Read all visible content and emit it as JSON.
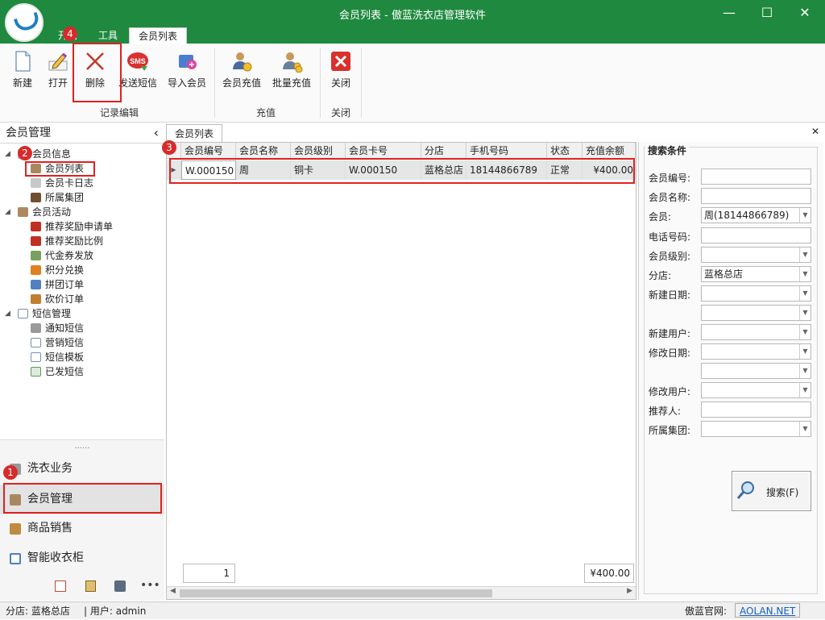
{
  "window": {
    "title": "会员列表 - 傲蓝洗衣店管理软件",
    "minimize": "—",
    "maximize": "☐",
    "close": "✕"
  },
  "menu_tabs": [
    {
      "label": "开始"
    },
    {
      "label": "工具"
    },
    {
      "label": "会员列表"
    }
  ],
  "ribbon": {
    "buttons": [
      {
        "label": "新建",
        "icon": "new-document-icon"
      },
      {
        "label": "打开",
        "icon": "edit-pencil-icon"
      },
      {
        "label": "删除",
        "icon": "delete-x-icon"
      },
      {
        "label": "发送短信",
        "icon": "sms-icon"
      },
      {
        "label": "导入会员",
        "icon": "import-icon"
      },
      {
        "label": "会员充值",
        "icon": "member-coin-icon"
      },
      {
        "label": "批量充值",
        "icon": "batch-coin-icon"
      },
      {
        "label": "关闭",
        "icon": "close-red-icon"
      }
    ],
    "groups": [
      "记录编辑",
      "充值",
      "关闭"
    ]
  },
  "sidebar": {
    "title": "会员管理",
    "collapse": "‹",
    "tree": [
      {
        "label": "会员信息",
        "level": 0,
        "icon": "member-folder-icon"
      },
      {
        "label": "会员列表",
        "level": 1,
        "icon": "member-icon"
      },
      {
        "label": "会员卡日志",
        "level": 1,
        "icon": "card-icon"
      },
      {
        "label": "所属集团",
        "level": 1,
        "icon": "group-icon"
      },
      {
        "label": "会员活动",
        "level": 0,
        "icon": "member-activity-icon"
      },
      {
        "label": "推荐奖励申请单",
        "level": 1,
        "icon": "reward-icon"
      },
      {
        "label": "推荐奖励比例",
        "level": 1,
        "icon": "reward-icon"
      },
      {
        "label": "代金券发放",
        "level": 1,
        "icon": "voucher-icon"
      },
      {
        "label": "积分兑换",
        "level": 1,
        "icon": "points-icon"
      },
      {
        "label": "拼团订单",
        "level": 1,
        "icon": "team-icon"
      },
      {
        "label": "砍价订单",
        "level": 1,
        "icon": "bargain-icon"
      },
      {
        "label": "短信管理",
        "level": 0,
        "icon": "mail-icon"
      },
      {
        "label": "通知短信",
        "level": 1,
        "icon": "speaker-icon"
      },
      {
        "label": "营销短信",
        "level": 1,
        "icon": "mail-icon"
      },
      {
        "label": "短信模板",
        "level": 1,
        "icon": "mail-icon"
      },
      {
        "label": "已发短信",
        "level": 1,
        "icon": "sent-mail-icon"
      }
    ],
    "grip": "......",
    "nav": [
      {
        "label": "洗衣业务",
        "icon": "laundry-icon"
      },
      {
        "label": "会员管理",
        "icon": "member-icon"
      },
      {
        "label": "商品销售",
        "icon": "box-icon"
      },
      {
        "label": "智能收衣柜",
        "icon": "cabinet-icon"
      }
    ],
    "more": "•••"
  },
  "doc_tab": {
    "label": "会员列表",
    "close": "✕"
  },
  "grid": {
    "columns": [
      "会员编号",
      "会员名称",
      "会员级别",
      "会员卡号",
      "分店",
      "手机号码",
      "状态",
      "充值余额"
    ],
    "rows": [
      [
        "W.000150",
        "周",
        "铜卡",
        "W.000150",
        "蓝格总店",
        "18144866789",
        "正常",
        "¥400.00"
      ]
    ],
    "footer_count": "1",
    "footer_total": "¥400.00"
  },
  "search": {
    "title": "搜索条件",
    "fields": [
      {
        "label": "会员编号:",
        "value": "",
        "dropdown": false
      },
      {
        "label": "会员名称:",
        "value": "",
        "dropdown": false
      },
      {
        "label": "会员:",
        "value": "周(18144866789)",
        "dropdown": true
      },
      {
        "label": "电话号码:",
        "value": "",
        "dropdown": false
      },
      {
        "label": "会员级别:",
        "value": "",
        "dropdown": true
      },
      {
        "label": "分店:",
        "value": "蓝格总店",
        "dropdown": true
      },
      {
        "label": "新建日期:",
        "value": "",
        "dropdown": true
      },
      {
        "label": "",
        "value": "",
        "dropdown": true
      },
      {
        "label": "新建用户:",
        "value": "",
        "dropdown": true
      },
      {
        "label": "修改日期:",
        "value": "",
        "dropdown": true
      },
      {
        "label": "",
        "value": "",
        "dropdown": true
      },
      {
        "label": "修改用户:",
        "value": "",
        "dropdown": true
      },
      {
        "label": "推荐人:",
        "value": "",
        "dropdown": false
      },
      {
        "label": "所属集团:",
        "value": "",
        "dropdown": true
      }
    ],
    "button": "搜索(F)"
  },
  "status": {
    "store": "分店: 蓝格总店",
    "user": "| 用户: admin",
    "site_label": "傲蓝官网:",
    "site": "AOLAN.NET"
  },
  "badges": [
    "1",
    "2",
    "3",
    "4"
  ],
  "colors": {
    "titlebar": "#1f8a3f",
    "highlight": "#e02020",
    "badge": "#d72b2b",
    "link": "#1060c0"
  }
}
